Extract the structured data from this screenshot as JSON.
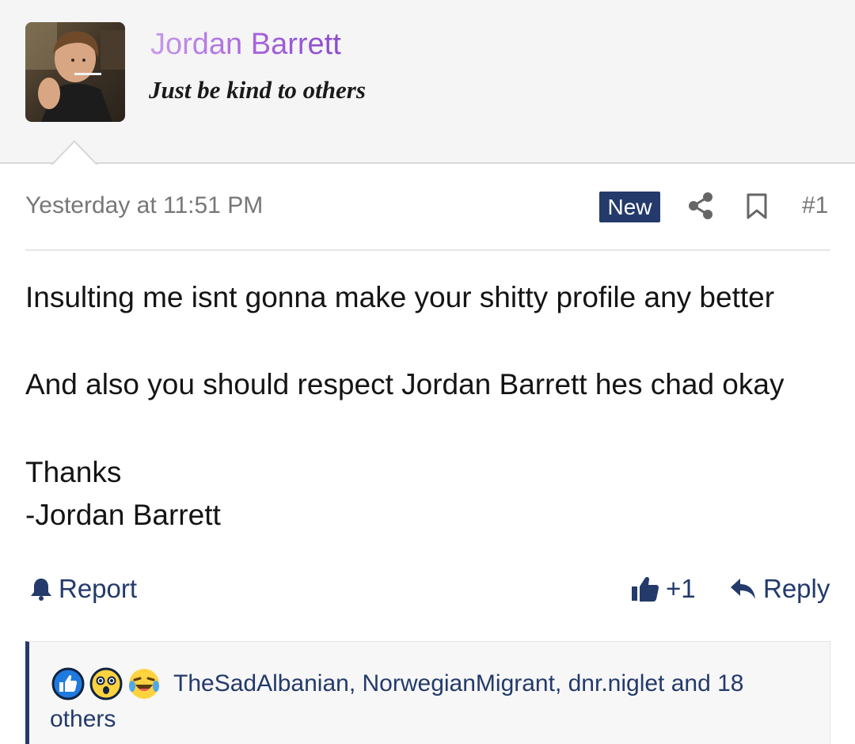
{
  "user": {
    "name": "Jordan Barrett",
    "title": "Just be kind to others"
  },
  "post": {
    "date": "Yesterday at 11:51 PM",
    "badge": "New",
    "number": "#1",
    "body": [
      "Insulting me isnt gonna make your shitty profile any better",
      "And also you should respect Jordan Barrett hes chad okay",
      "Thanks",
      "-Jordan Barrett"
    ]
  },
  "actions": {
    "report_label": "Report",
    "like_count": "+1",
    "reply_label": "Reply"
  },
  "reactions": {
    "icons": [
      "like-reaction-icon",
      "wow-reaction-icon",
      "haha-reaction-icon"
    ],
    "text": "TheSadAlbanian, NorwegianMigrant, dnr.niglet and 18 others"
  },
  "colors": {
    "accent": "#233a6b",
    "username_gradient_start": "#c89be8",
    "username_gradient_end": "#8a4bd1",
    "header_bg": "#f5f5f5"
  }
}
